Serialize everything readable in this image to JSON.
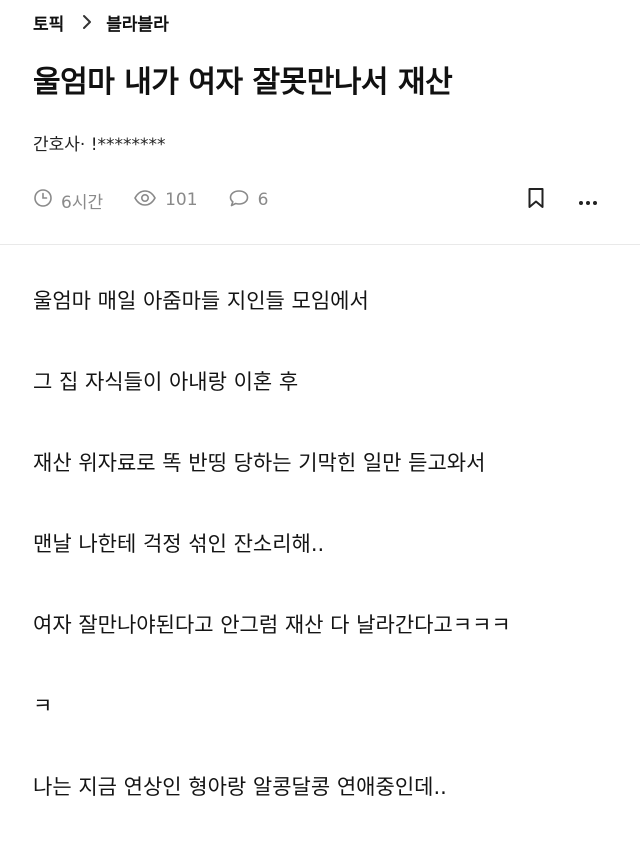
{
  "breadcrumb": {
    "topic": "토픽",
    "board": "블라블라"
  },
  "post": {
    "title": "울엄마 내가 여자 잘못만나서 재산",
    "author": "간호사· !********",
    "meta": {
      "time": "6시간",
      "views": "101",
      "comments": "6"
    },
    "paragraphs": [
      "울엄마 매일 아줌마들 지인들 모임에서",
      "그 집 자식들이 아내랑 이혼 후",
      "재산 위자료로 똑 반띵 당하는 기막힌 일만 듣고와서",
      "맨날 나한테 걱정 섞인 잔소리해..",
      "여자 잘만나야된다고 안그럼 재산 다 날라간다고ㅋㅋㅋ",
      "ㅋ",
      "나는 지금 연상인 형아랑 알콩달콩 연애중인데.."
    ]
  },
  "icons": {
    "breadcrumb_sep": "chevron-right-icon",
    "time": "clock-icon",
    "views": "eye-icon",
    "comments": "speech-bubble-icon",
    "bookmark": "bookmark-icon",
    "more": "more-icon"
  }
}
